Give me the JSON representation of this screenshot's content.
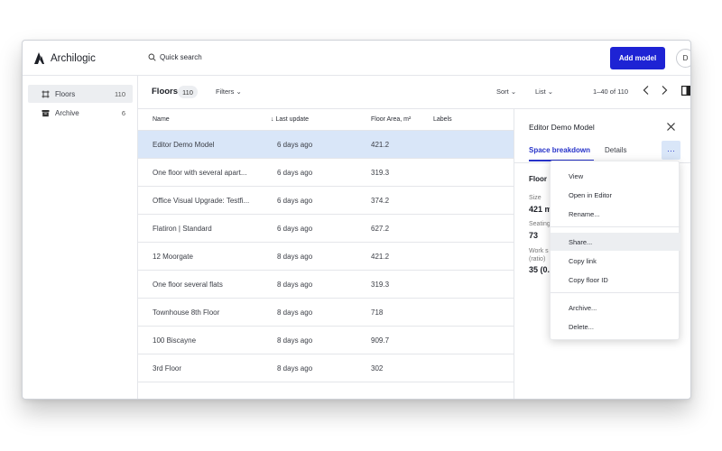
{
  "app": {
    "name": "Archilogic"
  },
  "topbar": {
    "search_label": "Quick search",
    "add_model_label": "Add model",
    "avatar_initial": "D"
  },
  "sidebar": {
    "items": [
      {
        "label": "Floors",
        "count": "110",
        "icon": "floor-plan-icon",
        "active": true
      },
      {
        "label": "Archive",
        "count": "6",
        "icon": "archive-box-icon",
        "active": false
      }
    ]
  },
  "header": {
    "title": "Floors",
    "count": "110",
    "filters_label": "Filters",
    "sort_label": "Sort",
    "view_label": "List",
    "pagination": "1–40 of 110"
  },
  "table": {
    "columns": {
      "name": "Name",
      "last_update": "↓ Last update",
      "floor_area": "Floor Area, m²",
      "labels": "Labels"
    },
    "rows": [
      {
        "name": "Editor Demo Model",
        "updated": "6 days ago",
        "area": "421.2",
        "selected": true
      },
      {
        "name": "One floor with several apart...",
        "updated": "6 days ago",
        "area": "319.3"
      },
      {
        "name": "Office Visual Upgrade: Testfi...",
        "updated": "6 days ago",
        "area": "374.2"
      },
      {
        "name": "Flatiron | Standard",
        "updated": "6 days ago",
        "area": "627.2"
      },
      {
        "name": "12 Moorgate",
        "updated": "8 days ago",
        "area": "421.2"
      },
      {
        "name": "One floor several flats",
        "updated": "8 days ago",
        "area": "319.3"
      },
      {
        "name": "Townhouse 8th Floor",
        "updated": "8 days ago",
        "area": "718"
      },
      {
        "name": "100 Biscayne",
        "updated": "8 days ago",
        "area": "909.7"
      },
      {
        "name": "3rd Floor",
        "updated": "8 days ago",
        "area": "302"
      }
    ]
  },
  "panel": {
    "title": "Editor Demo Model",
    "tabs": [
      "Space breakdown",
      "Details"
    ],
    "active_tab": "Space breakdown",
    "more_label": "···",
    "section_title": "Floor",
    "size_label": "Size",
    "size_value": "421 m",
    "seating_label": "Seating",
    "seating_value": "73",
    "work_label": "Work s",
    "ratio_label": "(ratio)",
    "work_value": "35 (0."
  },
  "menu": {
    "items": [
      "View",
      "Open in Editor",
      "Rename...",
      "Share...",
      "Copy link",
      "Copy floor ID",
      "Archive...",
      "Delete..."
    ],
    "hovered": "Share..."
  },
  "colors": {
    "accent": "#1e23d4",
    "selected_row": "#d9e6f8",
    "tab_active": "#2733c9"
  }
}
